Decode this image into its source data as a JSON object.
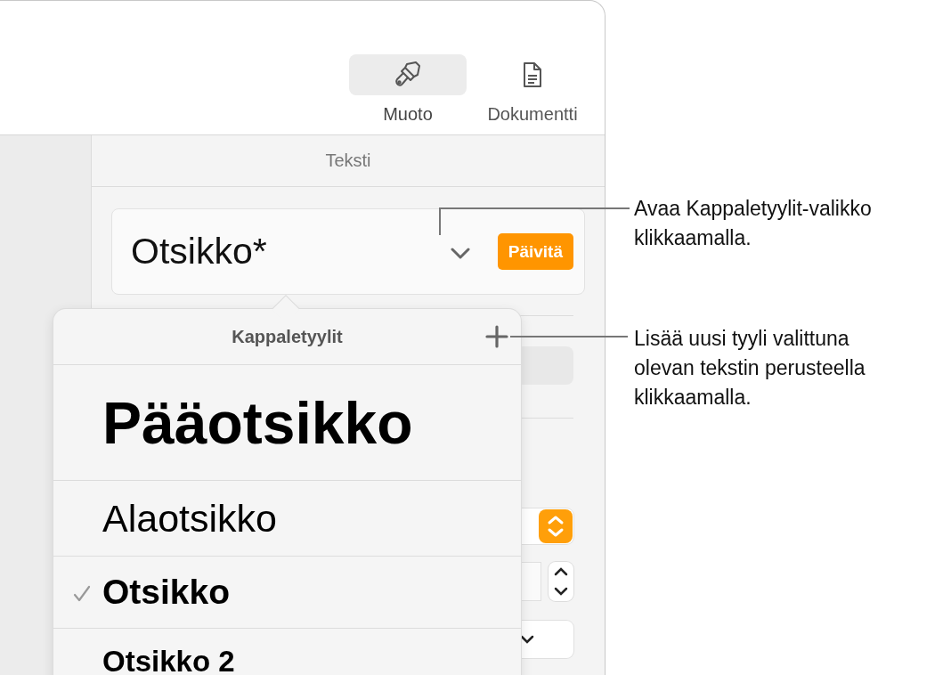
{
  "toolbar": {
    "tabs": [
      {
        "label": "Muoto",
        "kind": "format",
        "selected": true
      },
      {
        "label": "Dokumentti",
        "kind": "document",
        "selected": false
      }
    ]
  },
  "inspector": {
    "section_title": "Teksti",
    "paragraph_style": {
      "value": "Otsikko*",
      "update_button": "Päivitä"
    }
  },
  "style_menu": {
    "title": "Kappaletyylit",
    "styles": [
      {
        "label": "Pääotsikko",
        "kind": "title",
        "checked": false
      },
      {
        "label": "Alaotsikko",
        "kind": "subtitle",
        "checked": false
      },
      {
        "label": "Otsikko",
        "kind": "heading",
        "checked": true
      },
      {
        "label": "Otsikko 2",
        "kind": "heading2",
        "checked": false
      }
    ]
  },
  "callouts": [
    {
      "text": "Avaa Kappaletyylit-valikko\nklikkaamalla."
    },
    {
      "text": "Lisää uusi tyyli valittuna\nolevan tekstin perusteella\nklikkaamalla."
    }
  ]
}
